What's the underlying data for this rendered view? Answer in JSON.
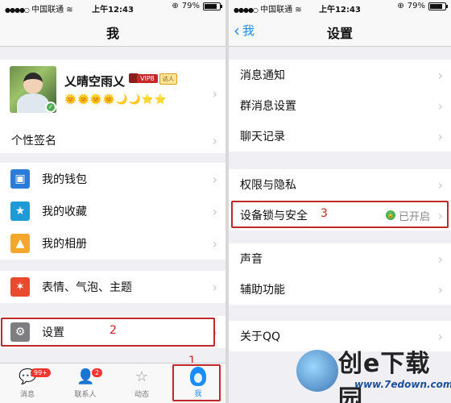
{
  "left": {
    "status": {
      "carrier": "中国联通",
      "time": "上午12:43",
      "battery": "79%"
    },
    "nav_title": "我",
    "profile": {
      "nickname": "乂晴空雨乂",
      "vip": "VIP8",
      "daren": "达人",
      "levels": "🌞🌞🌞🌞🌙🌙⭐⭐"
    },
    "signature": "个性签名",
    "items": {
      "wallet": "我的钱包",
      "favorites": "我的收藏",
      "album": "我的相册",
      "emoji": "表情、气泡、主题",
      "settings": "设置"
    },
    "annotations": {
      "one": "1",
      "two": "2"
    },
    "tabbar": {
      "messages": {
        "label": "消息",
        "badge": "99+"
      },
      "contacts": {
        "label": "联系人",
        "badge": "2"
      },
      "moments": {
        "label": "动态"
      },
      "me": {
        "label": "我"
      }
    }
  },
  "right": {
    "status": {
      "carrier": "中国联通",
      "time": "上午12:43",
      "battery": "79%"
    },
    "back_label": "我",
    "nav_title": "设置",
    "items": {
      "notify": "消息通知",
      "group": "群消息设置",
      "chat": "聊天记录",
      "privacy": "权限与隐私",
      "lock": "设备锁与安全",
      "lock_status": "已开启",
      "sound": "声音",
      "assist": "辅助功能",
      "about": "关于QQ"
    },
    "annotations": {
      "three": "3"
    }
  },
  "watermark": {
    "brand": "创e下载园",
    "url": "www.7edown.com"
  }
}
